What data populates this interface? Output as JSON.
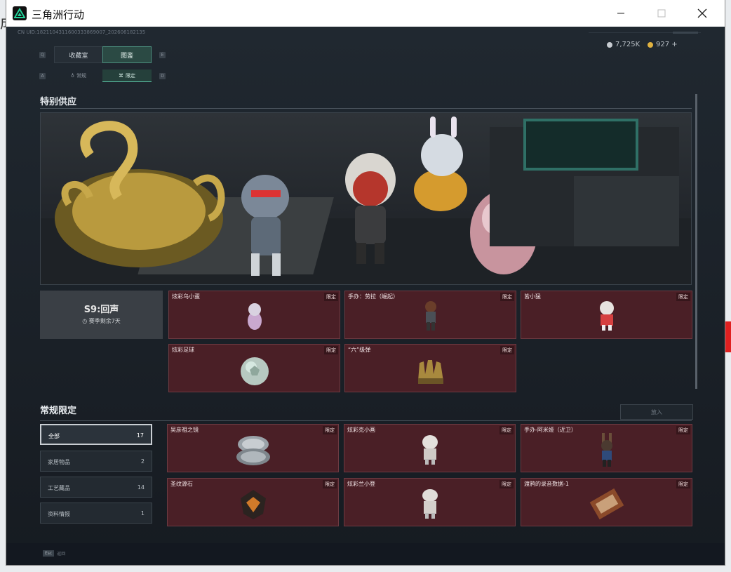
{
  "window": {
    "title": "三角洲行动",
    "minimize_icon": "minimize-icon",
    "maximize_icon": "maximize-icon",
    "close_icon": "close-icon"
  },
  "header": {
    "uid": "CN UID:1821104311600333869007_202606182135",
    "currency": [
      {
        "value": "7,725K",
        "color": "#c7ccd1"
      },
      {
        "value": "927 +",
        "color": "#e0b240"
      }
    ]
  },
  "nav": {
    "tabs": [
      {
        "label": "收藏室",
        "active": false
      },
      {
        "label": "图鉴",
        "active": true
      }
    ],
    "prev_key": "Q",
    "next_key": "E",
    "subtabs": [
      {
        "label": "常规",
        "active": false
      },
      {
        "label": "限定",
        "active": true
      }
    ],
    "sub_prev_key": "A",
    "sub_next_key": "D"
  },
  "special": {
    "title": "特别供应",
    "season": {
      "title": "S9:回声",
      "subtitle": "赛季剩余7天"
    },
    "items": [
      {
        "name": "炫彩乌小蛋",
        "tag": "限定",
        "icon": "egg-figure-icon"
      },
      {
        "name": "手办：劳拉（崛起）",
        "tag": "限定",
        "icon": "lara-figure-icon"
      },
      {
        "name": "皆小猛",
        "tag": "限定",
        "icon": "chibi-figure-icon"
      },
      {
        "name": "炫彩足球",
        "tag": "限定",
        "icon": "football-icon"
      },
      {
        "name": "“六”级弹",
        "tag": "限定",
        "icon": "gloves-icon"
      }
    ]
  },
  "regular": {
    "title": "常规限定",
    "confirm_label": "放入",
    "filters": [
      {
        "label": "全部",
        "count": "17",
        "active": true
      },
      {
        "label": "家居物品",
        "count": "2",
        "active": false
      },
      {
        "label": "工艺藏品",
        "count": "14",
        "active": false
      },
      {
        "label": "资料情报",
        "count": "1",
        "active": false
      }
    ],
    "items": [
      {
        "name": "吴彦祖之镜",
        "tag": "限定",
        "icon": "compact-mirror-icon"
      },
      {
        "name": "炫彩克小画",
        "tag": "限定",
        "icon": "chibi-figure-icon"
      },
      {
        "name": "手办-阿米娅（近卫）",
        "tag": "限定",
        "icon": "amiya-figure-icon"
      },
      {
        "name": "圣纹源石",
        "tag": "限定",
        "icon": "originium-icon"
      },
      {
        "name": "炫彩兰小登",
        "tag": "限定",
        "icon": "chibi-figure-icon"
      },
      {
        "name": "渡鸦的录音数据-1",
        "tag": "限定",
        "icon": "recorder-icon"
      }
    ]
  },
  "footer": {
    "key": "Esc",
    "label": "返回"
  }
}
